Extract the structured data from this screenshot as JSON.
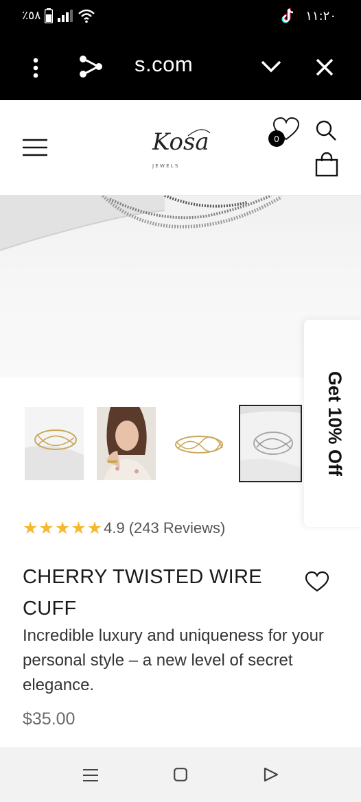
{
  "status_bar": {
    "battery_percent": "٪٥٨",
    "time": "١١:٢٠"
  },
  "browser": {
    "url": "s.com"
  },
  "header": {
    "wishlist_count": "0",
    "logo_word": "Kosa",
    "logo_sub": "J E W E L S"
  },
  "promo": {
    "label": "Get 10% Off"
  },
  "product": {
    "rating_value": 4.9,
    "rating_display": "4.9",
    "reviews": "(243 Reviews)",
    "title": "CHERRY TWISTED WIRE CUFF",
    "description": "Incredible luxury and uniqueness for your personal style – a new level of secret elegance.",
    "price": "$35.00",
    "thumbnails": [
      "gold-cuff-on-stand",
      "model-wearing-cuff",
      "gold-cuff-flat",
      "silver-cuff-on-stand"
    ],
    "selected_thumbnail": 3
  },
  "colors": {
    "star": "#f5b92e",
    "text_dark": "#1a1a1a",
    "price": "#6b6b6b"
  }
}
